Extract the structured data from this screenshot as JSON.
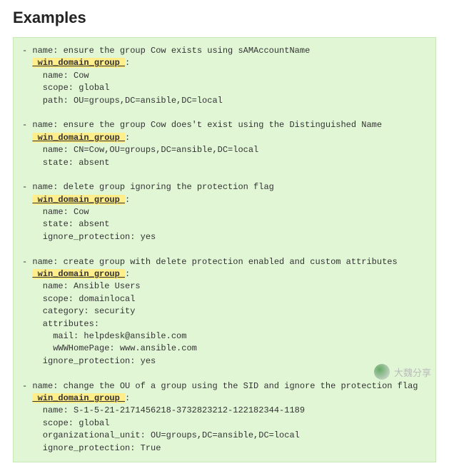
{
  "heading": "Examples",
  "module_key": "win_domain_group",
  "colon": ":",
  "examples": [
    {
      "name": "ensure the group Cow exists using sAMAccountName",
      "props": [
        "name: Cow",
        "scope: global",
        "path: OU=groups,DC=ansible,DC=local"
      ]
    },
    {
      "name": "ensure the group Cow does't exist using the Distinguished Name",
      "props": [
        "name: CN=Cow,OU=groups,DC=ansible,DC=local",
        "state: absent"
      ]
    },
    {
      "name": "delete group ignoring the protection flag",
      "props": [
        "name: Cow",
        "state: absent",
        "ignore_protection: yes"
      ]
    },
    {
      "name": "create group with delete protection enabled and custom attributes",
      "props": [
        "name: Ansible Users",
        "scope: domainlocal",
        "category: security",
        "attributes:",
        "  mail: helpdesk@ansible.com",
        "  wWWHomePage: www.ansible.com",
        "ignore_protection: yes"
      ]
    },
    {
      "name": "change the OU of a group using the SID and ignore the protection flag",
      "props": [
        "name: S-1-5-21-2171456218-3732823212-122182344-1189",
        "scope: global",
        "organizational_unit: OU=groups,DC=ansible,DC=local",
        "ignore_protection: True"
      ]
    }
  ],
  "watermark_text": "大魏分享"
}
